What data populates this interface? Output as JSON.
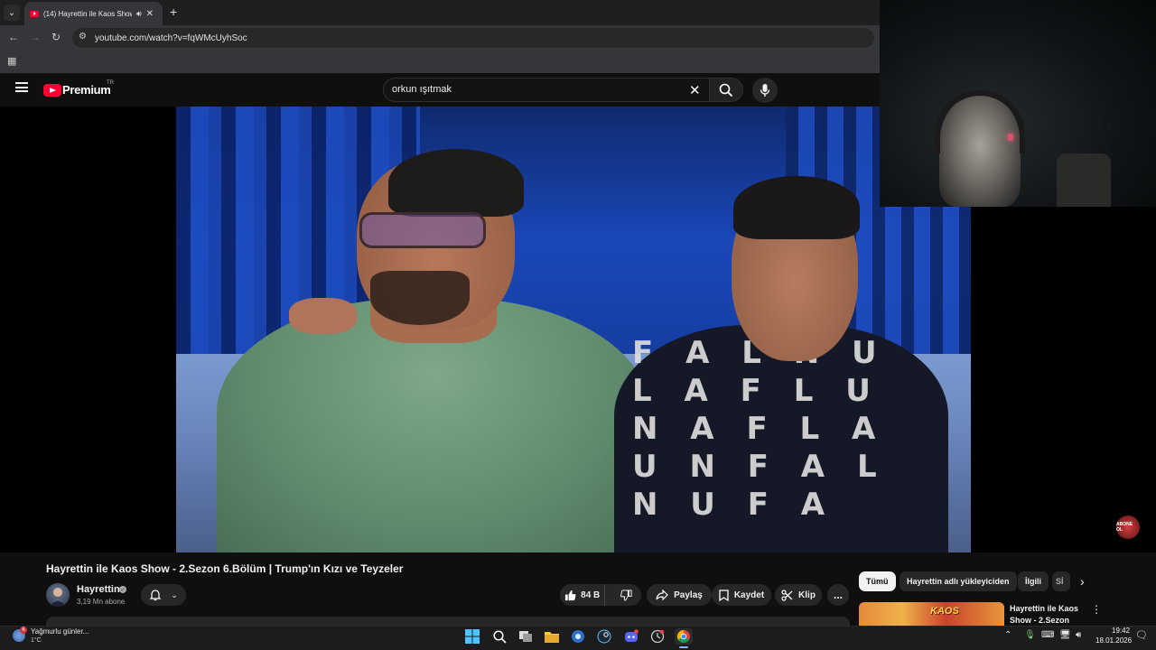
{
  "browser": {
    "tab_title": "(14) Hayrettin ile Kaos Show",
    "url": "youtube.com/watch?v=fqWMcUyhSoc"
  },
  "masthead": {
    "brand": "Premium",
    "region": "TR",
    "search_value": "orkun ışıtmak"
  },
  "video": {
    "title": "Hayrettin ile Kaos Show - 2.Sezon 6.Bölüm | Trump'ın Kızı ve Teyzeler",
    "channel": "Hayrettin",
    "subscribers": "3,19 Mn abone",
    "jacket_letters": "F A L N U L A F L U N A F L A U N F A L N U F A",
    "watermark": "ABONE OL"
  },
  "actions": {
    "likes": "84 B",
    "share": "Paylaş",
    "save": "Kaydet",
    "clip": "Klip",
    "more": "..."
  },
  "chips": [
    "Tümü",
    "Hayrettin adlı yükleyiciden",
    "İlgili",
    "Sİ"
  ],
  "recommendation": {
    "thumb_label": "KAOS",
    "title": "Hayrettin ile Kaos Show - 2.Sezon"
  },
  "taskbar": {
    "weather_text": "Yağmurlu günler...",
    "weather_temp": "1°C",
    "weather_badge": "6",
    "time": "19:42",
    "date": "18.01.2026"
  },
  "colors": {
    "youtube_red": "#ff0033",
    "background": "#0f0f0f",
    "pill": "#272727"
  }
}
